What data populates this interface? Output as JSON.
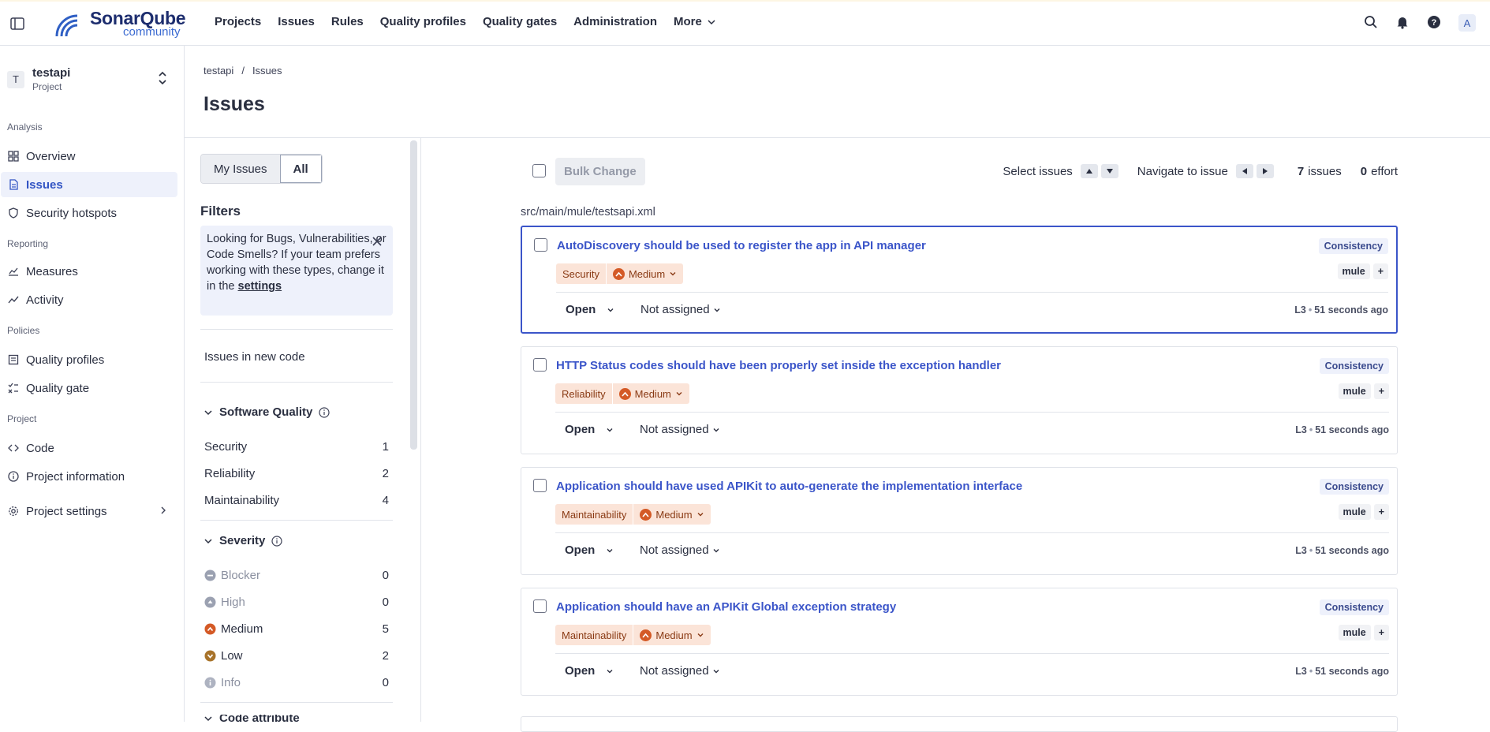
{
  "app": {
    "logo_main": "SonarQube",
    "logo_sub": "community"
  },
  "nav": {
    "items": [
      "Projects",
      "Issues",
      "Rules",
      "Quality profiles",
      "Quality gates",
      "Administration"
    ],
    "more_label": "More",
    "avatar_initial": "A"
  },
  "project": {
    "badge": "T",
    "name": "testapi",
    "type": "Project"
  },
  "sidebar": {
    "sections": {
      "analysis": "Analysis",
      "reporting": "Reporting",
      "policies": "Policies",
      "project": "Project"
    },
    "items": {
      "overview": "Overview",
      "issues": "Issues",
      "hotspots": "Security hotspots",
      "measures": "Measures",
      "activity": "Activity",
      "quality_profiles": "Quality profiles",
      "quality_gate": "Quality gate",
      "code": "Code",
      "project_info": "Project information",
      "project_settings": "Project settings"
    }
  },
  "breadcrumb": {
    "project": "testapi",
    "separator": "/",
    "page": "Issues"
  },
  "page_title": "Issues",
  "filters": {
    "my_issues": "My Issues",
    "all": "All",
    "title": "Filters",
    "notice_text": "Looking for Bugs, Vulnerabilities, or Code Smells? If your team prefers working with these types, change it in the",
    "notice_link": "settings",
    "new_code": "Issues in new code",
    "software_quality": {
      "label": "Software Quality",
      "rows": [
        {
          "label": "Security",
          "count": "1"
        },
        {
          "label": "Reliability",
          "count": "2"
        },
        {
          "label": "Maintainability",
          "count": "4"
        }
      ]
    },
    "severity": {
      "label": "Severity",
      "rows": [
        {
          "label": "Blocker",
          "count": "0"
        },
        {
          "label": "High",
          "count": "0"
        },
        {
          "label": "Medium",
          "count": "5"
        },
        {
          "label": "Low",
          "count": "2"
        },
        {
          "label": "Info",
          "count": "0"
        }
      ]
    },
    "next_facet": "Code attribute"
  },
  "toolbar": {
    "bulk_change": "Bulk Change",
    "select_issues": "Select issues",
    "navigate": "Navigate to issue",
    "issues_count": "7",
    "issues_label": "issues",
    "effort_count": "0",
    "effort_label": "effort"
  },
  "file_path": "src/main/mule/testsapi.xml",
  "issues": [
    {
      "title": "AutoDiscovery should be used to register the app in API manager",
      "attribute": "Consistency",
      "quality": "Security",
      "severity": "Medium",
      "tag": "mule",
      "status": "Open",
      "assignee": "Not assigned",
      "line": "L3",
      "time": "51 seconds ago"
    },
    {
      "title": "HTTP Status codes should have been properly set inside the exception handler",
      "attribute": "Consistency",
      "quality": "Reliability",
      "severity": "Medium",
      "tag": "mule",
      "status": "Open",
      "assignee": "Not assigned",
      "line": "L3",
      "time": "51 seconds ago"
    },
    {
      "title": "Application should have used APIKit to auto-generate the implementation interface",
      "attribute": "Consistency",
      "quality": "Maintainability",
      "severity": "Medium",
      "tag": "mule",
      "status": "Open",
      "assignee": "Not assigned",
      "line": "L3",
      "time": "51 seconds ago"
    },
    {
      "title": "Application should have an APIKit Global exception strategy",
      "attribute": "Consistency",
      "quality": "Maintainability",
      "severity": "Medium",
      "tag": "mule",
      "status": "Open",
      "assignee": "Not assigned",
      "line": "L3",
      "time": "51 seconds ago"
    }
  ]
}
